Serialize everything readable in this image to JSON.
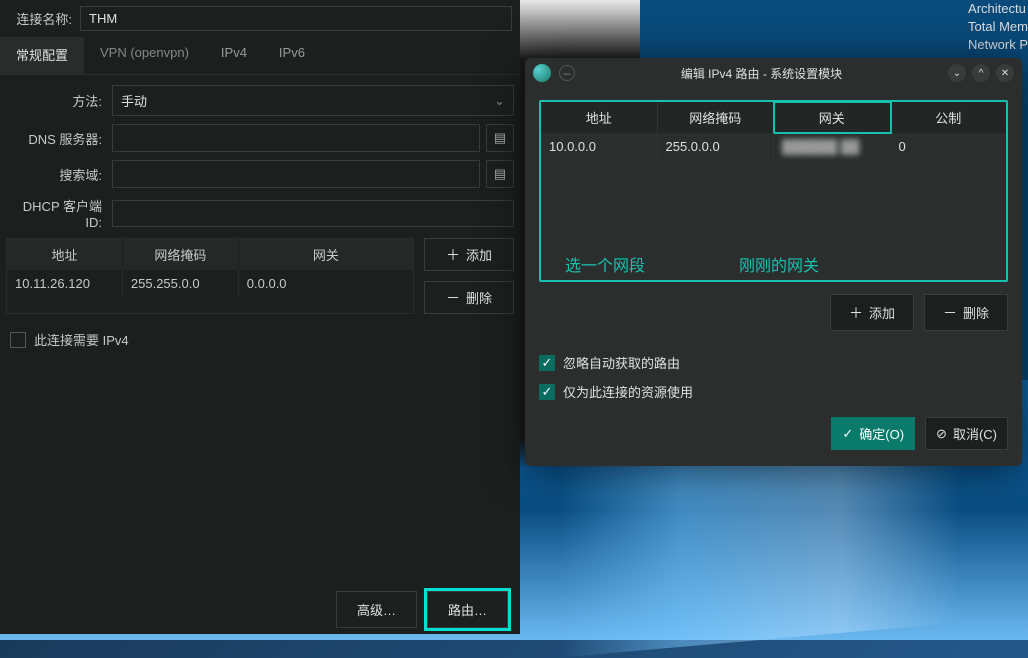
{
  "sysinfo": {
    "arch": "Architectu",
    "mem": "Total Mem",
    "net": "Network P"
  },
  "main": {
    "conn_name_label": "连接名称:",
    "conn_name_value": "THM",
    "tabs": {
      "general": "常规配置",
      "vpn": "VPN (openvpn)",
      "ipv4": "IPv4",
      "ipv6": "IPv6"
    },
    "method_label": "方法:",
    "method_value": "手动",
    "dns_label": "DNS 服务器:",
    "search_label": "搜索域:",
    "dhcp_label": "DHCP 客户端 ID:",
    "table_head": {
      "addr": "地址",
      "mask": "网络掩码",
      "gw": "网关"
    },
    "table_row": {
      "addr": "10.11.26.120",
      "mask": "255.255.0.0",
      "gw": "0.0.0.0"
    },
    "add": "添加",
    "remove": "删除",
    "require_ipv4": "此连接需要 IPv4",
    "advanced": "高级…",
    "routes": "路由…"
  },
  "dialog": {
    "title": "编辑 IPv4 路由 - 系统设置模块",
    "dash": "–",
    "min": "⌄",
    "max": "^",
    "close": "✕",
    "thead": {
      "addr": "地址",
      "mask": "网络掩码",
      "gw": "网关",
      "metric": "公制"
    },
    "row": {
      "addr": "10.0.0.0",
      "mask": "255.0.0.0",
      "gw": "██████ ██",
      "metric": "0"
    },
    "annot1": "选一个网段",
    "annot2": "刚刚的网关",
    "add": "添加",
    "remove": "删除",
    "ignore_auto": "忽略自动获取的路由",
    "only_this": "仅为此连接的资源使用",
    "ok": "确定(O)",
    "cancel": "取消(C)"
  }
}
